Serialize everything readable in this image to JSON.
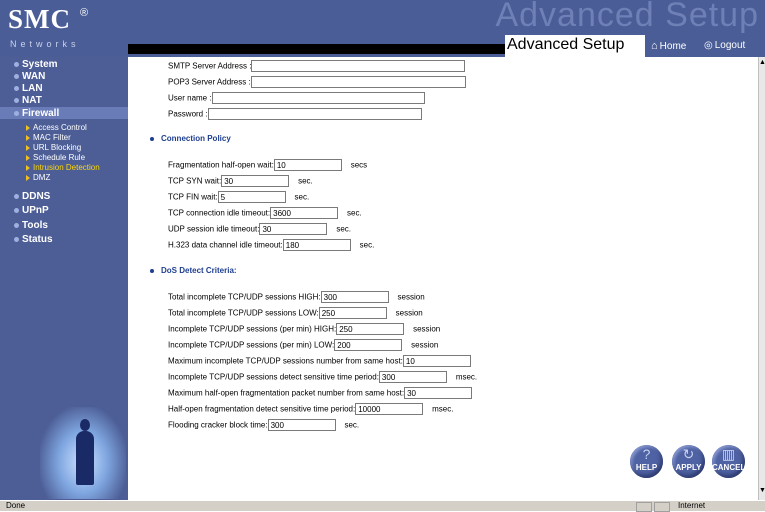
{
  "header": {
    "brand": "SMC",
    "brand_mark": "®",
    "brand_sub": "Networks",
    "watermark": "Advanced Setup",
    "title": "Advanced Setup",
    "home_label": "Home",
    "logout_label": "Logout",
    "home_icon": "home-icon",
    "logout_icon": "logout-icon"
  },
  "sidebar": {
    "items": [
      {
        "label": "System"
      },
      {
        "label": "WAN"
      },
      {
        "label": "LAN"
      },
      {
        "label": "NAT"
      },
      {
        "label": "Firewall",
        "active": true
      },
      {
        "label": "DDNS"
      },
      {
        "label": "UPnP"
      },
      {
        "label": "Tools"
      },
      {
        "label": "Status"
      }
    ],
    "firewall_sub": [
      {
        "label": "Access Control"
      },
      {
        "label": "MAC Filter"
      },
      {
        "label": "URL Blocking"
      },
      {
        "label": "Schedule Rule"
      },
      {
        "label": "Intrusion Detection",
        "current": true
      },
      {
        "label": "DMZ"
      }
    ]
  },
  "email": {
    "smtp_label": "SMTP Server Address :",
    "smtp_value": "",
    "pop3_label": "POP3 Server Address :",
    "pop3_value": "",
    "user_label": "User name :",
    "user_value": "",
    "pass_label": "Password :",
    "pass_value": ""
  },
  "connection_policy": {
    "title": "Connection Policy",
    "fields": [
      {
        "label": "Fragmentation half-open wait:",
        "value": "10",
        "unit": "secs"
      },
      {
        "label": "TCP SYN wait:",
        "value": "30",
        "unit": "sec."
      },
      {
        "label": "TCP FIN wait:",
        "value": "5",
        "unit": "sec."
      },
      {
        "label": "TCP connection idle timeout:",
        "value": "3600",
        "unit": "sec."
      },
      {
        "label": "UDP session idle timeout:",
        "value": "30",
        "unit": "sec."
      },
      {
        "label": "H.323 data channel idle timeout:",
        "value": "180",
        "unit": "sec."
      }
    ]
  },
  "dos": {
    "title": "DoS Detect Criteria:",
    "fields": [
      {
        "label": "Total incomplete TCP/UDP sessions HIGH:",
        "value": "300",
        "unit": "session"
      },
      {
        "label": "Total incomplete TCP/UDP sessions LOW:",
        "value": "250",
        "unit": "session"
      },
      {
        "label": "Incomplete TCP/UDP sessions (per min) HIGH:",
        "value": "250",
        "unit": "session"
      },
      {
        "label": "Incomplete TCP/UDP sessions (per min) LOW:",
        "value": "200",
        "unit": "session"
      },
      {
        "label": "Maximum incomplete TCP/UDP sessions number from same host:",
        "value": "10",
        "unit": ""
      },
      {
        "label": "Incomplete TCP/UDP sessions detect sensitive time period:",
        "value": "300",
        "unit": "msec."
      },
      {
        "label": "Maximum half-open fragmentation packet number from same host:",
        "value": "30",
        "unit": ""
      },
      {
        "label": "Half-open fragmentation detect sensitive time period:",
        "value": "10000",
        "unit": "msec."
      },
      {
        "label": "Flooding cracker block time:",
        "value": "300",
        "unit": "sec."
      }
    ]
  },
  "buttons": {
    "help": "HELP",
    "apply": "APPLY",
    "cancel": "CANCEL"
  },
  "statusbar": {
    "text": "Done",
    "zone": "Internet"
  }
}
